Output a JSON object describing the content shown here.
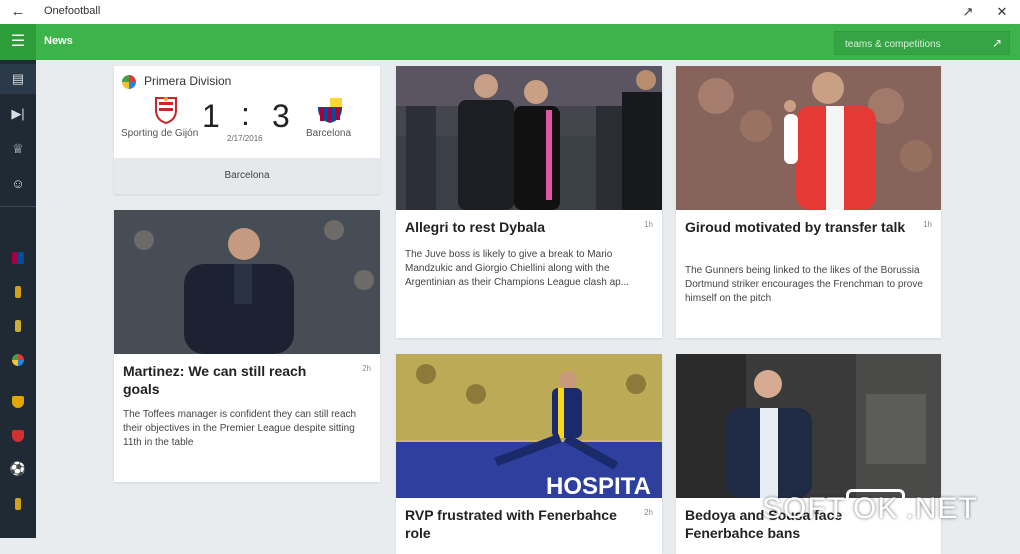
{
  "window": {
    "title": "Onefootball"
  },
  "header": {
    "title": "News",
    "search_placeholder": "teams & competitions"
  },
  "sidebar": {
    "items": [
      "news",
      "matches",
      "tables",
      "players",
      "scores"
    ]
  },
  "match": {
    "league": "Primera Division",
    "home_team": "Sporting de Gijón",
    "away_team": "Barcelona",
    "home_score": "1",
    "separator": ":",
    "away_score": "3",
    "date": "2/17/2016",
    "footer": "Barcelona"
  },
  "articles": [
    {
      "title": "Allegri to rest Dybala",
      "time": "1h",
      "desc": "The Juve boss is likely to give a break to Mario Mandzukic and Giorgio Chiellini along with the Argentinian as their Champions League clash ap..."
    },
    {
      "title": "Giroud motivated by transfer talk",
      "time": "1h",
      "desc": "The Gunners being linked to the likes of the Borussia Dortmund striker encourages the Frenchman to prove himself on the pitch"
    },
    {
      "title": "Martinez: We can still reach goals",
      "time": "2h",
      "desc": "The Toffees manager is confident they can still reach their objectives in the Premier League despite sitting 11th in the table"
    },
    {
      "title": "RVP frustrated with Fenerbahce role",
      "time": "2h",
      "desc": ""
    },
    {
      "title": "Bedoya and Sousa face Fenerbahce bans",
      "time": "",
      "desc": ""
    }
  ],
  "ad_text": "HOSPITA",
  "watermark": {
    "left": "SOFT",
    "box": "OK",
    "right": ".NET"
  },
  "colors": {
    "accent": "#3cb44a",
    "sidebar": "#1f2a35"
  }
}
